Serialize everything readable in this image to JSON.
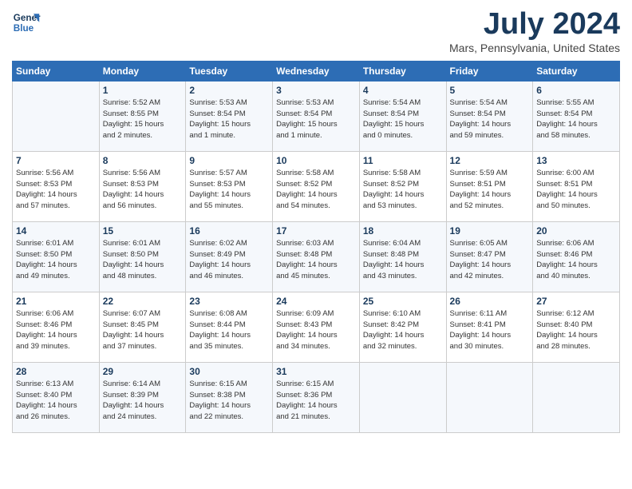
{
  "logo": {
    "line1": "General",
    "line2": "Blue"
  },
  "title": "July 2024",
  "location": "Mars, Pennsylvania, United States",
  "days_of_week": [
    "Sunday",
    "Monday",
    "Tuesday",
    "Wednesday",
    "Thursday",
    "Friday",
    "Saturday"
  ],
  "weeks": [
    [
      {
        "day": "",
        "info": ""
      },
      {
        "day": "1",
        "info": "Sunrise: 5:52 AM\nSunset: 8:55 PM\nDaylight: 15 hours\nand 2 minutes."
      },
      {
        "day": "2",
        "info": "Sunrise: 5:53 AM\nSunset: 8:54 PM\nDaylight: 15 hours\nand 1 minute."
      },
      {
        "day": "3",
        "info": "Sunrise: 5:53 AM\nSunset: 8:54 PM\nDaylight: 15 hours\nand 1 minute."
      },
      {
        "day": "4",
        "info": "Sunrise: 5:54 AM\nSunset: 8:54 PM\nDaylight: 15 hours\nand 0 minutes."
      },
      {
        "day": "5",
        "info": "Sunrise: 5:54 AM\nSunset: 8:54 PM\nDaylight: 14 hours\nand 59 minutes."
      },
      {
        "day": "6",
        "info": "Sunrise: 5:55 AM\nSunset: 8:54 PM\nDaylight: 14 hours\nand 58 minutes."
      }
    ],
    [
      {
        "day": "7",
        "info": "Sunrise: 5:56 AM\nSunset: 8:53 PM\nDaylight: 14 hours\nand 57 minutes."
      },
      {
        "day": "8",
        "info": "Sunrise: 5:56 AM\nSunset: 8:53 PM\nDaylight: 14 hours\nand 56 minutes."
      },
      {
        "day": "9",
        "info": "Sunrise: 5:57 AM\nSunset: 8:53 PM\nDaylight: 14 hours\nand 55 minutes."
      },
      {
        "day": "10",
        "info": "Sunrise: 5:58 AM\nSunset: 8:52 PM\nDaylight: 14 hours\nand 54 minutes."
      },
      {
        "day": "11",
        "info": "Sunrise: 5:58 AM\nSunset: 8:52 PM\nDaylight: 14 hours\nand 53 minutes."
      },
      {
        "day": "12",
        "info": "Sunrise: 5:59 AM\nSunset: 8:51 PM\nDaylight: 14 hours\nand 52 minutes."
      },
      {
        "day": "13",
        "info": "Sunrise: 6:00 AM\nSunset: 8:51 PM\nDaylight: 14 hours\nand 50 minutes."
      }
    ],
    [
      {
        "day": "14",
        "info": "Sunrise: 6:01 AM\nSunset: 8:50 PM\nDaylight: 14 hours\nand 49 minutes."
      },
      {
        "day": "15",
        "info": "Sunrise: 6:01 AM\nSunset: 8:50 PM\nDaylight: 14 hours\nand 48 minutes."
      },
      {
        "day": "16",
        "info": "Sunrise: 6:02 AM\nSunset: 8:49 PM\nDaylight: 14 hours\nand 46 minutes."
      },
      {
        "day": "17",
        "info": "Sunrise: 6:03 AM\nSunset: 8:48 PM\nDaylight: 14 hours\nand 45 minutes."
      },
      {
        "day": "18",
        "info": "Sunrise: 6:04 AM\nSunset: 8:48 PM\nDaylight: 14 hours\nand 43 minutes."
      },
      {
        "day": "19",
        "info": "Sunrise: 6:05 AM\nSunset: 8:47 PM\nDaylight: 14 hours\nand 42 minutes."
      },
      {
        "day": "20",
        "info": "Sunrise: 6:06 AM\nSunset: 8:46 PM\nDaylight: 14 hours\nand 40 minutes."
      }
    ],
    [
      {
        "day": "21",
        "info": "Sunrise: 6:06 AM\nSunset: 8:46 PM\nDaylight: 14 hours\nand 39 minutes."
      },
      {
        "day": "22",
        "info": "Sunrise: 6:07 AM\nSunset: 8:45 PM\nDaylight: 14 hours\nand 37 minutes."
      },
      {
        "day": "23",
        "info": "Sunrise: 6:08 AM\nSunset: 8:44 PM\nDaylight: 14 hours\nand 35 minutes."
      },
      {
        "day": "24",
        "info": "Sunrise: 6:09 AM\nSunset: 8:43 PM\nDaylight: 14 hours\nand 34 minutes."
      },
      {
        "day": "25",
        "info": "Sunrise: 6:10 AM\nSunset: 8:42 PM\nDaylight: 14 hours\nand 32 minutes."
      },
      {
        "day": "26",
        "info": "Sunrise: 6:11 AM\nSunset: 8:41 PM\nDaylight: 14 hours\nand 30 minutes."
      },
      {
        "day": "27",
        "info": "Sunrise: 6:12 AM\nSunset: 8:40 PM\nDaylight: 14 hours\nand 28 minutes."
      }
    ],
    [
      {
        "day": "28",
        "info": "Sunrise: 6:13 AM\nSunset: 8:40 PM\nDaylight: 14 hours\nand 26 minutes."
      },
      {
        "day": "29",
        "info": "Sunrise: 6:14 AM\nSunset: 8:39 PM\nDaylight: 14 hours\nand 24 minutes."
      },
      {
        "day": "30",
        "info": "Sunrise: 6:15 AM\nSunset: 8:38 PM\nDaylight: 14 hours\nand 22 minutes."
      },
      {
        "day": "31",
        "info": "Sunrise: 6:15 AM\nSunset: 8:36 PM\nDaylight: 14 hours\nand 21 minutes."
      },
      {
        "day": "",
        "info": ""
      },
      {
        "day": "",
        "info": ""
      },
      {
        "day": "",
        "info": ""
      }
    ]
  ]
}
